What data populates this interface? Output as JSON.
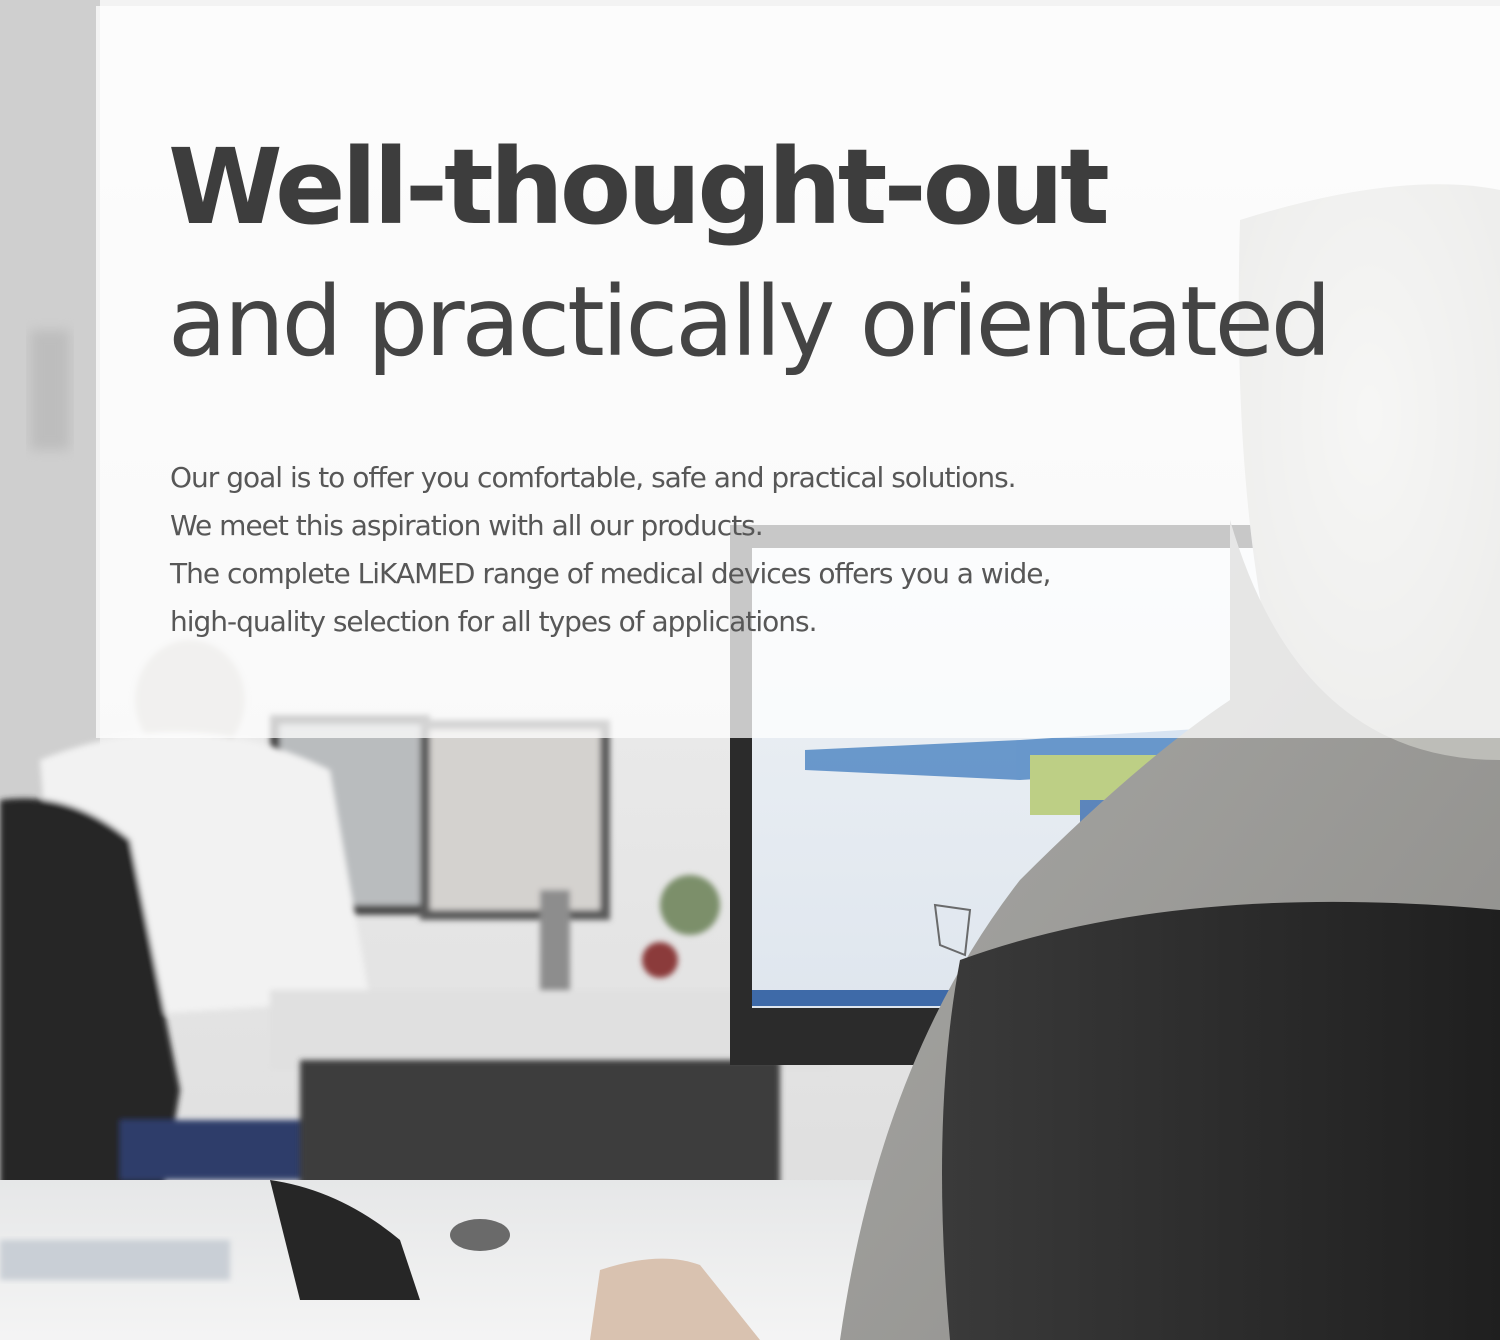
{
  "headline": {
    "bold": "Well-thought-out",
    "light": "and practically orientated"
  },
  "body": {
    "lines": [
      "Our goal is to offer you comfortable, safe and practical solutions.",
      "We meet this aspiration with all our products.",
      "The complete LiKAMED range of medical devices offers you a wide,",
      "high-quality selection for all types of applications."
    ]
  },
  "colors": {
    "headline": "#3d3d3d",
    "body_text": "#575757",
    "panel": "#ffffff"
  }
}
